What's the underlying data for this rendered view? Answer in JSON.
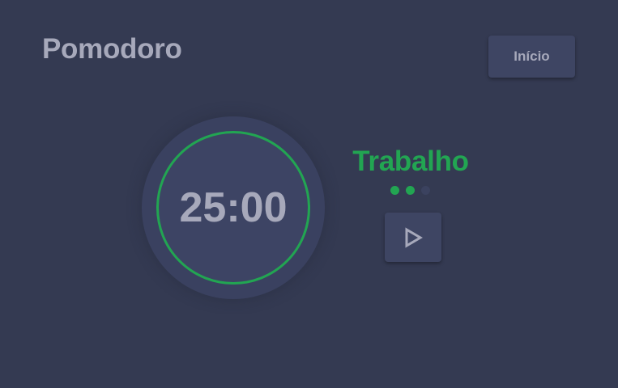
{
  "header": {
    "title": "Pomodoro",
    "home_label": "Início"
  },
  "timer": {
    "time": "25:00",
    "mode": "Trabalho",
    "sessions_total": 3,
    "sessions_completed": 2
  },
  "controls": {
    "play_icon": "play-icon"
  },
  "colors": {
    "background": "#343a52",
    "accent": "#22a552",
    "text": "#a7a9bb",
    "button": "#3e4563"
  }
}
